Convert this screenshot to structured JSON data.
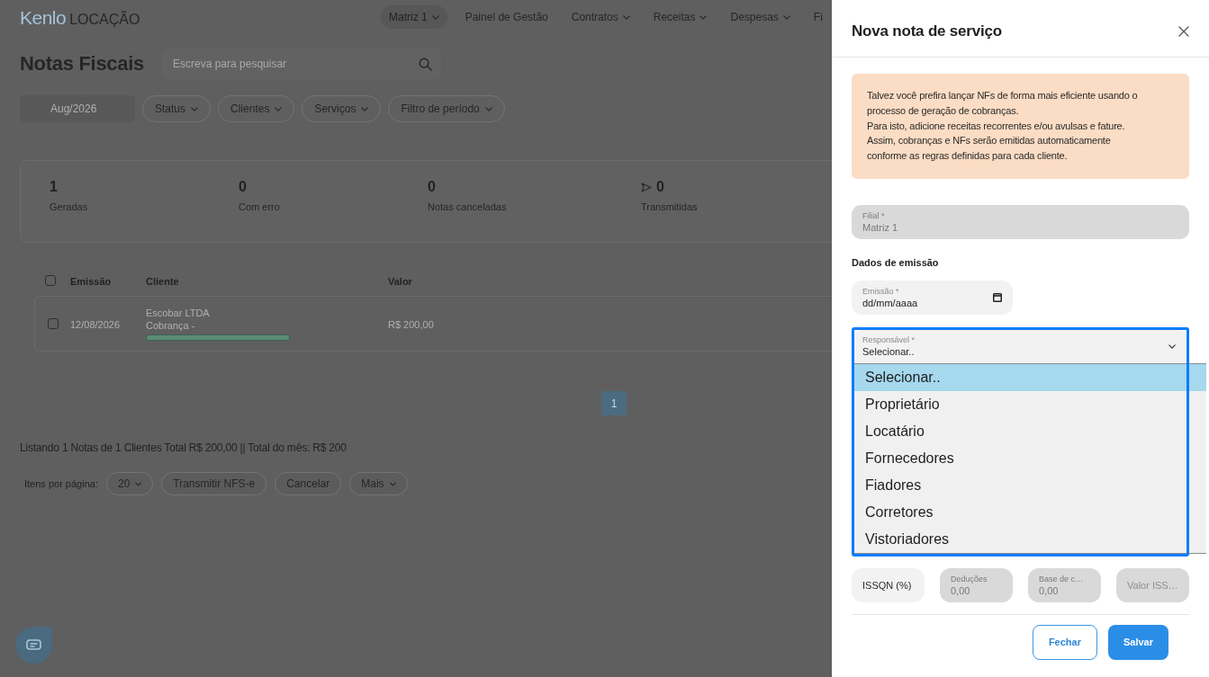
{
  "header": {
    "logo": {
      "brand": "Kenlo",
      "product": "LOCAÇÃO"
    },
    "nav": [
      {
        "label": "Matriz 1",
        "kind": "selector",
        "dropdown": true
      },
      {
        "label": "Painel de Gestão",
        "kind": "link",
        "dropdown": false
      },
      {
        "label": "Contratos",
        "kind": "link",
        "dropdown": true
      },
      {
        "label": "Receitas",
        "kind": "link",
        "dropdown": true
      },
      {
        "label": "Despesas",
        "kind": "link",
        "dropdown": true
      },
      {
        "label": "Fi",
        "kind": "link",
        "dropdown": false
      }
    ]
  },
  "page": {
    "title": "Notas Fiscais",
    "search": {
      "placeholder": "Escreva para pesquisar"
    },
    "filters": {
      "month": "Aug/2026",
      "dropdowns": [
        "Status",
        "Clientes",
        "Serviços",
        "Filtro de período"
      ]
    },
    "stats": [
      {
        "kind": "count",
        "value": "1",
        "label": "Geradas"
      },
      {
        "kind": "count",
        "value": "0",
        "label": "Com erro"
      },
      {
        "kind": "count",
        "value": "0",
        "label": "Notas canceladas"
      },
      {
        "kind": "sent",
        "value": "0",
        "label": "Transmitidas"
      }
    ],
    "table": {
      "all_checked": false,
      "columns": [
        "Emissão",
        "Cliente",
        "Valor"
      ],
      "rows": [
        {
          "checked": false,
          "emissao": "12/08/2026",
          "cliente": "Escobar LTDA",
          "detail": "Cobrança -",
          "level": 1,
          "valor": "R$ 200,00"
        }
      ]
    },
    "pagination": [
      {
        "label": "1",
        "selected": true
      }
    ],
    "summary": "Listando 1 Notas de 1 Clientes Total R$ 200,00 || Total do mês: R$ 200",
    "footer": {
      "per_page_label": "Itens por página:",
      "per_page": "20",
      "actions": [
        {
          "label": "Transmitir NFS-e",
          "dropdown": false
        },
        {
          "label": "Cancelar",
          "dropdown": false
        },
        {
          "label": "Mais",
          "dropdown": true
        }
      ]
    }
  },
  "drawer": {
    "title": "Nova nota de serviço",
    "notice": "Talvez você prefira lançar NFs de forma mais eficiente usando o\nprocesso de geração de cobranças.\nPara isto, adicione receitas recorrentes e/ou avulsas e fature.\nAssim, cobranças e NFs serão emitidas automaticamente\nconforme as regras definidas para cada cliente.",
    "branch": {
      "label": "Filial *",
      "value": "Matriz 1",
      "disabled": true
    },
    "section": "Dados de emissão",
    "issue_date": {
      "label": "Emissão *",
      "value": "dd/mm/aaaa"
    },
    "responsible": {
      "label": "Responsável *",
      "value": "Selecionar..",
      "expanded": true,
      "options": [
        {
          "label": "Selecionar..",
          "selected": true
        },
        {
          "label": "Proprietário",
          "selected": false
        },
        {
          "label": "Locatário",
          "selected": false
        },
        {
          "label": "Fornecedores",
          "selected": false
        },
        {
          "label": "Fiadores",
          "selected": false
        },
        {
          "label": "Corretores",
          "selected": false
        },
        {
          "label": "Vistoriadores",
          "selected": false
        }
      ]
    },
    "tax_fields": [
      {
        "kind": "placeholder",
        "placeholder": "ISSQN (%)",
        "disabled": false
      },
      {
        "kind": "labeled",
        "label": "Deduções",
        "value": "0,00",
        "disabled": true
      },
      {
        "kind": "labeled",
        "label": "Base de c…",
        "value": "0,00",
        "disabled": true
      },
      {
        "kind": "placeholder",
        "placeholder": "Valor ISS…",
        "disabled": true
      }
    ],
    "buttons": [
      {
        "label": "Fechar",
        "kind": "secondary"
      },
      {
        "label": "Salvar",
        "kind": "primary"
      }
    ]
  }
}
